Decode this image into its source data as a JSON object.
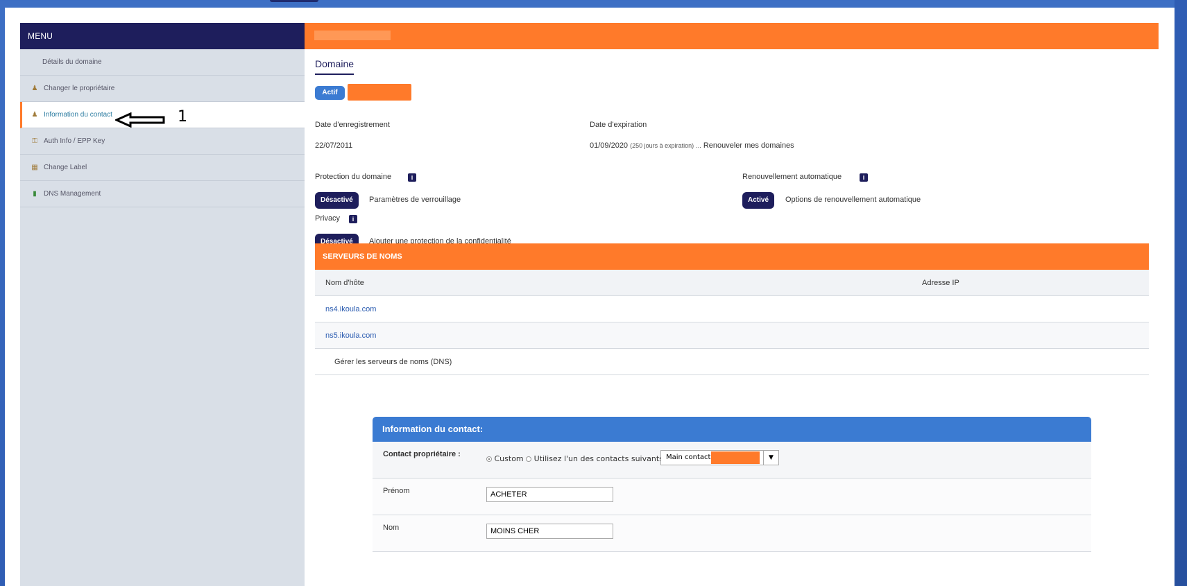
{
  "sidebar": {
    "title": "MENU",
    "items": [
      {
        "label": "Détails du domaine",
        "icon": "none"
      },
      {
        "label": "Changer le propriétaire",
        "icon": "owner-icon"
      },
      {
        "label": "Information du contact",
        "icon": "contact-icon"
      },
      {
        "label": "Auth Info / EPP Key",
        "icon": "key-icon"
      },
      {
        "label": "Change Label",
        "icon": "label-icon"
      },
      {
        "label": "DNS Management",
        "icon": "dns-icon"
      }
    ]
  },
  "annotation": {
    "number": "1"
  },
  "main": {
    "tab": "Domaine",
    "status_badge": "Actif",
    "registration": {
      "label": "Date d'enregistrement",
      "value": "22/07/2011"
    },
    "expiration": {
      "label": "Date d'expiration",
      "value": "01/09/2020",
      "note": "(250 jours à expiration)",
      "dots": "...",
      "renew_link": "Renouveler mes domaines"
    },
    "protection": {
      "label": "Protection du domaine",
      "badge": "Désactivé",
      "link": "Paramètres de verrouillage"
    },
    "auto_renew": {
      "label": "Renouvellement automatique",
      "badge": "Activé",
      "link": "Options de renouvellement automatique"
    },
    "privacy": {
      "label": "Privacy",
      "badge": "Désactivé",
      "link": "Ajouter une protection de la confidentialité"
    },
    "info_icon": "i"
  },
  "nameservers": {
    "title": "SERVEURS DE NOMS",
    "col_host": "Nom d'hôte",
    "col_ip": "Adresse IP",
    "rows": [
      {
        "host": "ns4.ikoula.com",
        "ip": ""
      },
      {
        "host": "ns5.ikoula.com",
        "ip": ""
      }
    ],
    "manage_link": "Gérer les serveurs de noms (DNS)"
  },
  "contact": {
    "title": "Information du contact:",
    "owner_label": "Contact propriétaire :",
    "radio_custom": "Custom",
    "radio_other": "Utilisez l'un des contacts suivants :",
    "select_value": "Main contact:",
    "firstname_label": "Prénom",
    "firstname_value": "ACHETER",
    "lastname_label": "Nom",
    "lastname_value": "MOINS CHER"
  },
  "colors": {
    "accent": "#ff7a2a",
    "navy": "#1e1e5c",
    "blue": "#3b7bd2"
  }
}
